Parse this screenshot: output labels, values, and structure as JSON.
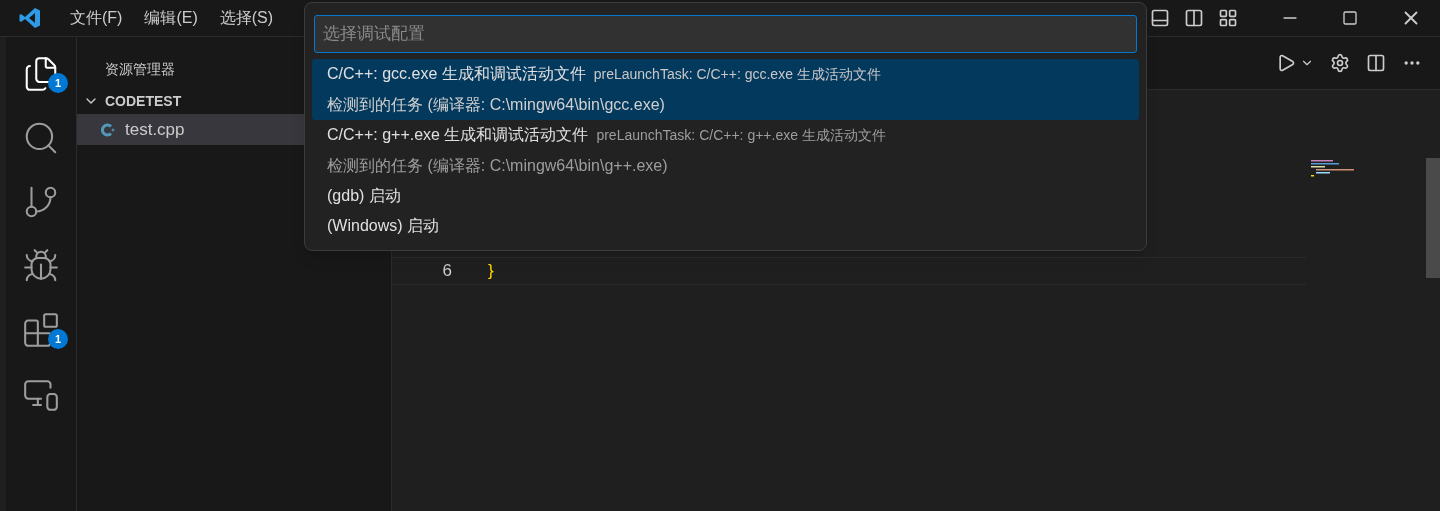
{
  "menu": [
    "文件(F)",
    "编辑(E)",
    "选择(S)"
  ],
  "activity_bar": [
    {
      "kind": "files",
      "badge": "1",
      "selected": true
    },
    {
      "kind": "search",
      "selected": false
    },
    {
      "kind": "source-control",
      "selected": false
    },
    {
      "kind": "run-debug",
      "selected": false
    },
    {
      "kind": "extensions",
      "badge": "1",
      "selected": false
    },
    {
      "kind": "remote",
      "selected": false
    }
  ],
  "sidebar": {
    "title": "资源管理器",
    "folder": {
      "name": "CODETEST",
      "expanded": true,
      "children": [
        {
          "name": "test.cpp",
          "selected": true
        }
      ]
    }
  },
  "quick_pick": {
    "placeholder": "选择调试配置",
    "items": [
      {
        "label": "C/C++: gcc.exe 生成和调试活动文件",
        "description": "preLaunchTask: C/C++: gcc.exe 生成活动文件",
        "detail": "检测到的任务 (编译器: C:\\mingw64\\bin\\gcc.exe)",
        "selected": true
      },
      {
        "label": "C/C++: g++.exe 生成和调试活动文件",
        "description": "preLaunchTask: C/C++: g++.exe 生成活动文件",
        "detail": "检测到的任务 (编译器: C:\\mingw64\\bin\\g++.exe)",
        "selected": false
      },
      {
        "label": "(gdb) 启动",
        "selected": false
      },
      {
        "label": "(Windows) 启动",
        "selected": false
      }
    ]
  },
  "editor": {
    "lines": [
      {
        "number": "6",
        "code": "}"
      }
    ]
  }
}
